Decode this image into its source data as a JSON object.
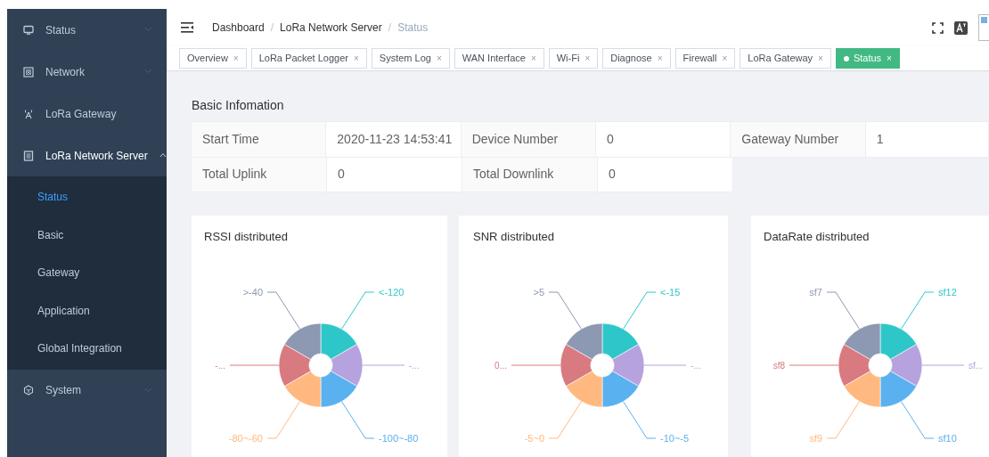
{
  "sidebar": {
    "items": [
      {
        "label": "Status",
        "expanded": false
      },
      {
        "label": "Network",
        "expanded": false
      },
      {
        "label": "LoRa Gateway"
      },
      {
        "label": "LoRa Network Server",
        "expanded": true,
        "children": [
          {
            "label": "Status",
            "selected": true
          },
          {
            "label": "Basic",
            "selected": false
          },
          {
            "label": "Gateway",
            "selected": false
          },
          {
            "label": "Application",
            "selected": false
          },
          {
            "label": "Global Integration",
            "selected": false
          }
        ]
      },
      {
        "label": "System",
        "expanded": false
      }
    ]
  },
  "breadcrumb": {
    "separator": "/",
    "items": [
      "Dashboard",
      "LoRa Network Server",
      "Status"
    ]
  },
  "tabs": [
    {
      "label": "Overview",
      "close": "×",
      "selected": false
    },
    {
      "label": "LoRa Packet Logger",
      "close": "×",
      "selected": false
    },
    {
      "label": "System Log",
      "close": "×",
      "selected": false
    },
    {
      "label": "WAN Interface",
      "close": "×",
      "selected": false
    },
    {
      "label": "Wi-Fi",
      "close": "×",
      "selected": false
    },
    {
      "label": "Diagnose",
      "close": "×",
      "selected": false
    },
    {
      "label": "Firewall",
      "close": "×",
      "selected": false
    },
    {
      "label": "LoRa Gateway",
      "close": "×",
      "selected": false
    },
    {
      "label": "Status",
      "close": "×",
      "selected": true
    }
  ],
  "basic_info": {
    "title": "Basic Infomation",
    "rows": [
      [
        "Start Time",
        "2020-11-23 14:53:41",
        "Device Number",
        "0",
        "Gateway Number",
        "1"
      ],
      [
        "Total Uplink",
        "0",
        "Total Downlink",
        "0"
      ]
    ]
  },
  "charts": [
    {
      "title": "RSSI distributed",
      "slices": [
        {
          "label": "<-120",
          "color": "#2ec7c9"
        },
        {
          "label": "-...",
          "color": "#b6a2de"
        },
        {
          "label": "-100~-80",
          "color": "#5ab1ef"
        },
        {
          "label": "-80~-60",
          "color": "#ffb980"
        },
        {
          "label": "-...",
          "color": "#d87a80"
        },
        {
          "label": ">-40",
          "color": "#8d98b3"
        }
      ]
    },
    {
      "title": "SNR distributed",
      "slices": [
        {
          "label": "<-15",
          "color": "#2ec7c9"
        },
        {
          "label": "-...",
          "color": "#b6a2de"
        },
        {
          "label": "-10~-5",
          "color": "#5ab1ef"
        },
        {
          "label": "-5~0",
          "color": "#ffb980"
        },
        {
          "label": "0...",
          "color": "#d87a80"
        },
        {
          "label": ">5",
          "color": "#8d98b3"
        }
      ]
    },
    {
      "title": "DataRate distributed",
      "slices": [
        {
          "label": "sf12",
          "color": "#2ec7c9"
        },
        {
          "label": "sf...",
          "color": "#b6a2de"
        },
        {
          "label": "sf10",
          "color": "#5ab1ef"
        },
        {
          "label": "sf9",
          "color": "#ffb980"
        },
        {
          "label": "sf8",
          "color": "#d87a80"
        },
        {
          "label": "sf7",
          "color": "#8d98b3"
        }
      ]
    }
  ]
}
